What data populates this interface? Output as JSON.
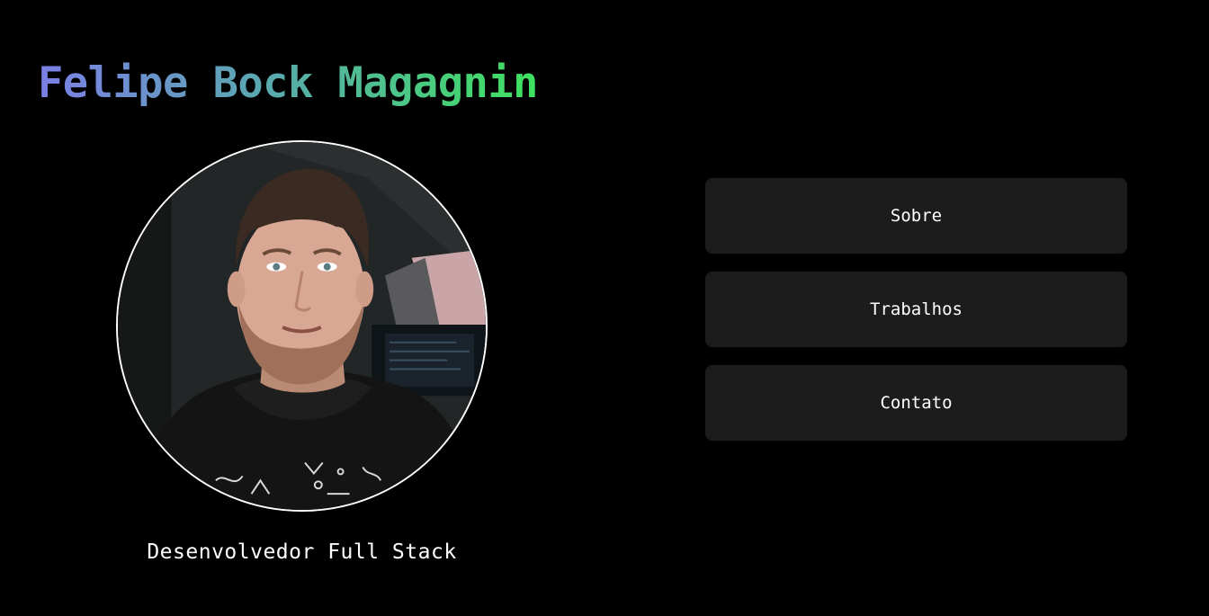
{
  "header": {
    "name": "Felipe Bock Magagnin"
  },
  "profile": {
    "avatar_icon": "profile-photo",
    "role": "Desenvolvedor Full Stack"
  },
  "nav": {
    "items": [
      {
        "label": "Sobre"
      },
      {
        "label": "Trabalhos"
      },
      {
        "label": "Contato"
      }
    ]
  },
  "colors": {
    "background": "#000000",
    "button_bg": "#1c1c1c",
    "gradient_start": "#7b7fe6",
    "gradient_mid": "#5aa8b0",
    "gradient_end": "#3fe25f",
    "text": "#ffffff"
  }
}
